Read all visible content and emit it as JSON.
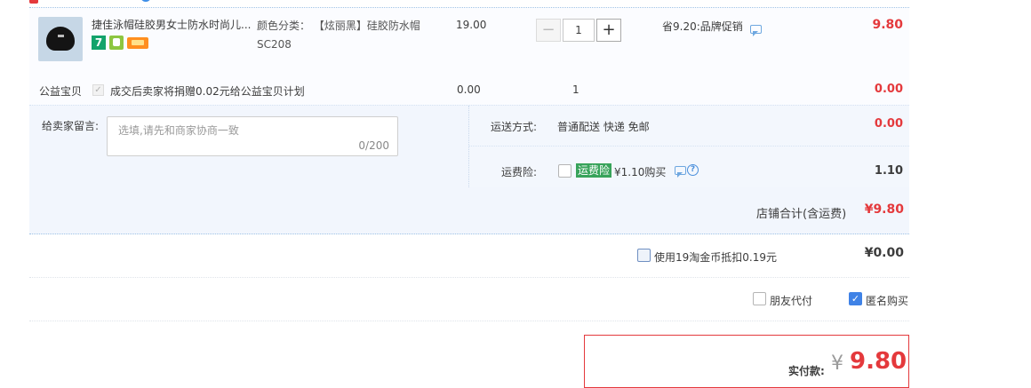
{
  "item": {
    "title": "捷佳泳帽硅胶男女士防水时尚儿...",
    "sku_label": "颜色分类：",
    "sku_value": "【炫丽黑】硅胶防水帽SC208",
    "unit_price": "19.00",
    "quantity": "1",
    "promo_text": "省9.20:品牌促销",
    "subtotal": "9.80",
    "badges": {
      "first": "7"
    }
  },
  "charity": {
    "label": "公益宝贝",
    "text": "成交后卖家将捐赠0.02元给公益宝贝计划",
    "price": "0.00",
    "quantity": "1",
    "total": "0.00"
  },
  "message": {
    "label": "给卖家留言:",
    "placeholder": "选填,请先和商家协商一致",
    "counter": "0/200"
  },
  "shipping": {
    "label": "运送方式:",
    "value": "普通配送 快递 免邮",
    "cost": "0.00"
  },
  "insurance": {
    "label": "运费险:",
    "badge": "运费险",
    "price_text": "¥1.10购买",
    "cost": "1.10"
  },
  "shop_total": {
    "label": "店铺合计(含运费)",
    "amount": "¥9.80"
  },
  "coins": {
    "text": "使用19淘金币抵扣0.19元",
    "amount": "¥0.00"
  },
  "options": {
    "friend_pay": "朋友代付",
    "anonymous": "匿名购买",
    "anonymous_checked": true
  },
  "payment": {
    "label": "实付款:",
    "currency": "¥",
    "amount": "9.80"
  }
}
